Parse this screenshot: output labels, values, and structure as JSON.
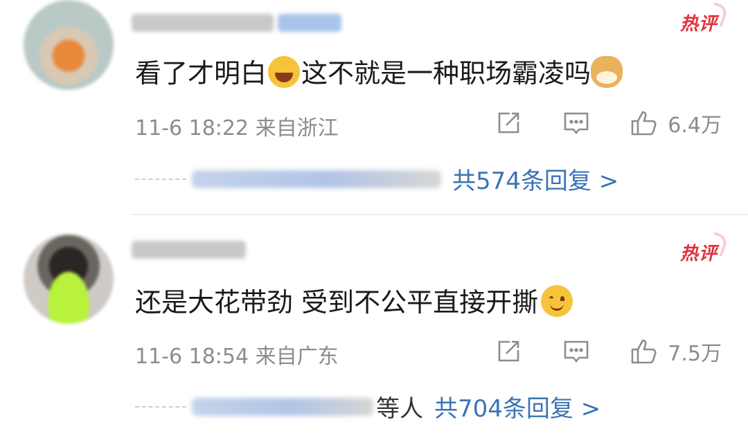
{
  "comments": [
    {
      "badge": "热评",
      "text_before": "看了才明白",
      "text_middle": "这不就是一种职场霸凌吗",
      "emojis": [
        "laugh-cry-emoji",
        "doge-emoji"
      ],
      "date_time": "11-6 18:22",
      "location": "来自浙江",
      "likes": "6.4万",
      "reply_link": "共574条回复 >",
      "repliers_suffix": ""
    },
    {
      "badge": "热评",
      "text_before": "还是大花带劲 受到不公平直接开撕",
      "emojis": [
        "smile-emoji"
      ],
      "date_time": "11-6 18:54",
      "location": "来自广东",
      "likes": "7.5万",
      "reply_link": "共704条回复 >",
      "repliers_suffix": "等人"
    }
  ],
  "colors": {
    "hot_badge": "#e0303a",
    "link": "#3a73b5",
    "meta": "#8c8c8c",
    "text": "#1a1a1a"
  },
  "icons": [
    "share-icon",
    "comment-icon",
    "like-icon"
  ]
}
